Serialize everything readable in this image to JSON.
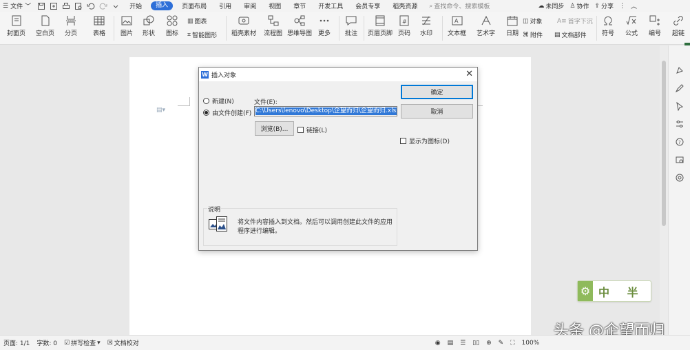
{
  "menubar": {
    "file_label": "文件",
    "tabs": [
      "开始",
      "插入",
      "页面布局",
      "引用",
      "审阅",
      "视图",
      "章节",
      "开发工具",
      "会员专享",
      "稻壳资源"
    ],
    "active_tab": "插入",
    "search_placeholder": "查找命令、搜索模板",
    "sync_label": "未同步",
    "collab_label": "协作",
    "share_label": "分享"
  },
  "ribbon": {
    "items": [
      "封面页",
      "空白页",
      "分页",
      "表格",
      "图片",
      "形状",
      "图标",
      "稻壳素材",
      "流程图",
      "思维导图",
      "更多",
      "批注",
      "页眉页脚",
      "页码",
      "水印",
      "文本框",
      "艺术字",
      "日期",
      "公式",
      "编号",
      "超链"
    ],
    "chart_label": "图表",
    "smart_label": "智能图形",
    "object_label": "对象",
    "dropcap_label": "首字下沉",
    "attachment_label": "附件",
    "docpart_label": "文档部件",
    "symbol_label": "符号"
  },
  "dialog": {
    "title": "插入对象",
    "option_new": "新建(N)",
    "option_from_file": "由文件创建(F)",
    "file_label": "文件(E):",
    "file_path": "C:\\Users\\lenovo\\Desktop\\企望而归\\企望而归.xlsx",
    "browse_label": "浏览(B)...",
    "link_label": "链接(L)",
    "ok_label": "确定",
    "cancel_label": "取消",
    "display_as_icon_label": "显示为图标(D)",
    "desc_group_label": "说明",
    "desc_text": "将文件内容插入到文档。然后可以调用创建此文件的应用程序进行编辑。"
  },
  "statusbar": {
    "page": "页面: 1/1",
    "words": "字数: 0",
    "spellcheck": "拼写检查",
    "doc_check": "文档校对",
    "zoom": "100%"
  },
  "watermark": {
    "brand_text": "中 半",
    "source_text": "头条 @企望而归"
  },
  "colors": {
    "accent": "#2e6fd8",
    "selection": "#3078d7"
  }
}
